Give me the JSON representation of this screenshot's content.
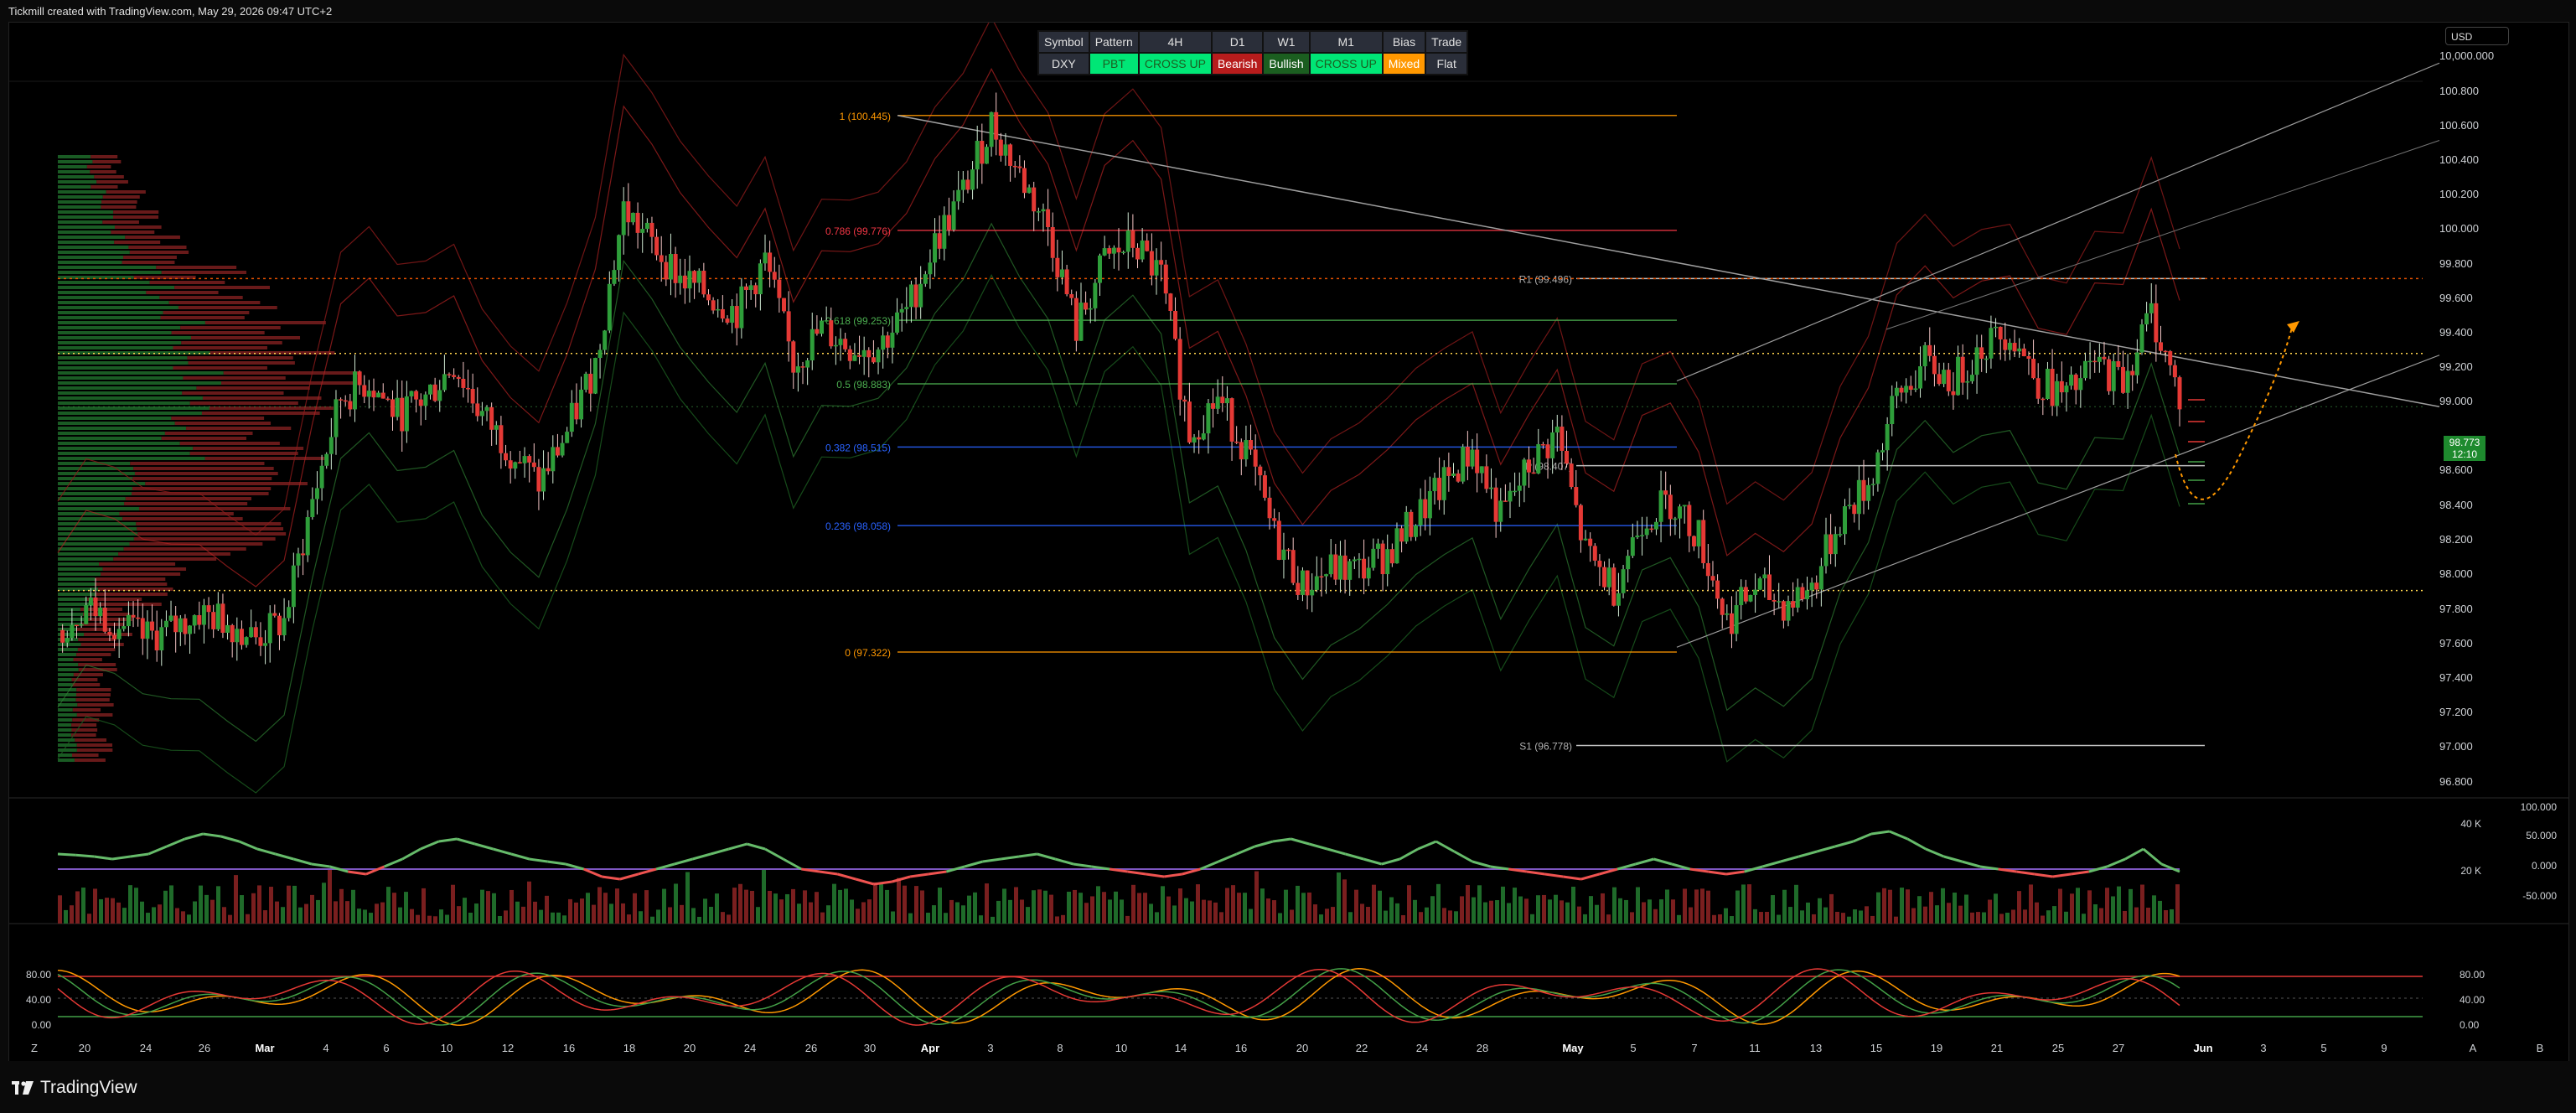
{
  "header": {
    "caption": "Tickmill created with TradingView.com, May 29, 2026 09:47 UTC+2"
  },
  "currency_selector": "USD",
  "signal_table": {
    "headers": [
      "Symbol",
      "Pattern",
      "4H",
      "D1",
      "W1",
      "M1",
      "Bias",
      "Trade"
    ],
    "values": [
      "DXY",
      "PBT",
      "CROSS UP",
      "Bearish",
      "Bullish",
      "CROSS UP",
      "Mixed",
      "Flat"
    ],
    "value_colors": [
      "#2a2e39",
      "#00e676",
      "#00e676",
      "#b71c1c",
      "#1b5e20",
      "#00e676",
      "#ff9800",
      "#2a2e39"
    ],
    "text_colors": [
      "#e0e0e0",
      "#1b5e20",
      "#1b5e20",
      "#ffffff",
      "#ffffff",
      "#1b5e20",
      "#ffffff",
      "#e0e0e0"
    ]
  },
  "last_price": {
    "value": "98.773",
    "countdown": "12:10"
  },
  "footer": {
    "brand": "TradingView"
  },
  "chart_data": [
    {
      "type": "candlestick",
      "symbol": "DXY",
      "price_axis": [
        "10,000.000",
        "100.800",
        "100.600",
        "100.400",
        "100.200",
        "100.000",
        "99.800",
        "99.600",
        "99.400",
        "99.200",
        "99.000",
        "98.600",
        "98.400",
        "98.200",
        "98.000",
        "97.800",
        "97.600",
        "97.400",
        "97.200",
        "97.000",
        "96.800"
      ],
      "time_axis": [
        "Z",
        "20",
        "24",
        "26",
        "Mar",
        "4",
        "6",
        "10",
        "12",
        "16",
        "18",
        "20",
        "24",
        "26",
        "30",
        "Apr",
        "3",
        "8",
        "10",
        "14",
        "16",
        "20",
        "22",
        "24",
        "28",
        "May",
        "5",
        "7",
        "11",
        "13",
        "15",
        "19",
        "21",
        "25",
        "27",
        "Jun",
        "3",
        "5",
        "9",
        "A",
        "B"
      ],
      "ylim": [
        96.7,
        100.85
      ],
      "close_series_approx": [
        97.45,
        97.6,
        97.5,
        97.4,
        97.45,
        97.55,
        97.5,
        97.4,
        97.5,
        98.2,
        98.8,
        98.9,
        98.7,
        98.8,
        99.0,
        98.7,
        98.5,
        98.3,
        98.6,
        99.0,
        99.9,
        99.7,
        99.5,
        99.4,
        99.3,
        99.6,
        99.0,
        99.2,
        99.1,
        99.1,
        99.3,
        99.7,
        100.0,
        100.4,
        100.1,
        99.8,
        99.2,
        99.6,
        99.7,
        99.5,
        98.6,
        98.8,
        98.5,
        98.0,
        97.7,
        97.8,
        97.8,
        97.9,
        98.1,
        98.3,
        98.5,
        98.1,
        98.4,
        98.6,
        97.9,
        97.7,
        98.1,
        98.2,
        98.0,
        97.5,
        97.7,
        97.6,
        97.7,
        98.1,
        98.3,
        98.8,
        99.0,
        98.9,
        99.1,
        99.2,
        98.9,
        98.8,
        99.0,
        98.9,
        99.3,
        98.8
      ],
      "fibonacci_levels": [
        {
          "label": "1 (100.445)",
          "value": 100.445,
          "color": "#ff9800"
        },
        {
          "label": "0.786 (99.776)",
          "value": 99.776,
          "color": "#f23645"
        },
        {
          "label": "0.618 (99.253)",
          "value": 99.253,
          "color": "#4caf50"
        },
        {
          "label": "0.5 (98.883)",
          "value": 98.883,
          "color": "#4caf50"
        },
        {
          "label": "0.382 (98.515)",
          "value": 98.515,
          "color": "#2962ff"
        },
        {
          "label": "0.236 (98.058)",
          "value": 98.058,
          "color": "#2962ff"
        },
        {
          "label": "0 (97.322)",
          "value": 97.322,
          "color": "#ff9800"
        }
      ],
      "pivots": [
        {
          "label": "R1 (99.496)",
          "value": 99.496
        },
        {
          "label": "P (98.407)",
          "value": 98.407
        },
        {
          "label": "S1 (96.778)",
          "value": 96.778
        }
      ],
      "horizontal_levels": [
        99.06,
        97.68
      ],
      "grid": false
    },
    {
      "type": "bar",
      "panel": "volume-oscillator",
      "left_axis": [
        "40 K",
        "20 K"
      ],
      "right_axis": [
        "100.000",
        "50.000",
        "0.000",
        "-50.000"
      ],
      "oscillator_series_approx": [
        30,
        28,
        25,
        20,
        25,
        30,
        45,
        60,
        70,
        65,
        55,
        40,
        30,
        20,
        10,
        5,
        -5,
        -10,
        5,
        20,
        40,
        55,
        60,
        50,
        40,
        30,
        20,
        15,
        10,
        0,
        -15,
        -20,
        -10,
        0,
        10,
        20,
        30,
        40,
        50,
        40,
        20,
        0,
        -5,
        -10,
        -20,
        -30,
        -25,
        -15,
        -10,
        -5,
        5,
        15,
        20,
        25,
        30,
        20,
        10,
        5,
        0,
        -5,
        -10,
        -15,
        -10,
        0,
        15,
        30,
        45,
        55,
        60,
        50,
        40,
        30,
        20,
        10,
        20,
        40,
        55,
        35,
        15,
        5,
        0,
        -5,
        -10,
        -15,
        -20,
        -10,
        0,
        10,
        20,
        10,
        0,
        -5,
        -10,
        -5,
        5,
        15,
        25,
        35,
        45,
        55,
        70,
        75,
        60,
        40,
        25,
        15,
        5,
        0,
        -5,
        -10,
        -15,
        -10,
        -5,
        5,
        20,
        40,
        10,
        -5
      ]
    },
    {
      "type": "line",
      "panel": "stochastic",
      "axis": [
        "80.00",
        "40.00",
        "0.00"
      ],
      "levels": [
        80,
        20
      ]
    }
  ]
}
